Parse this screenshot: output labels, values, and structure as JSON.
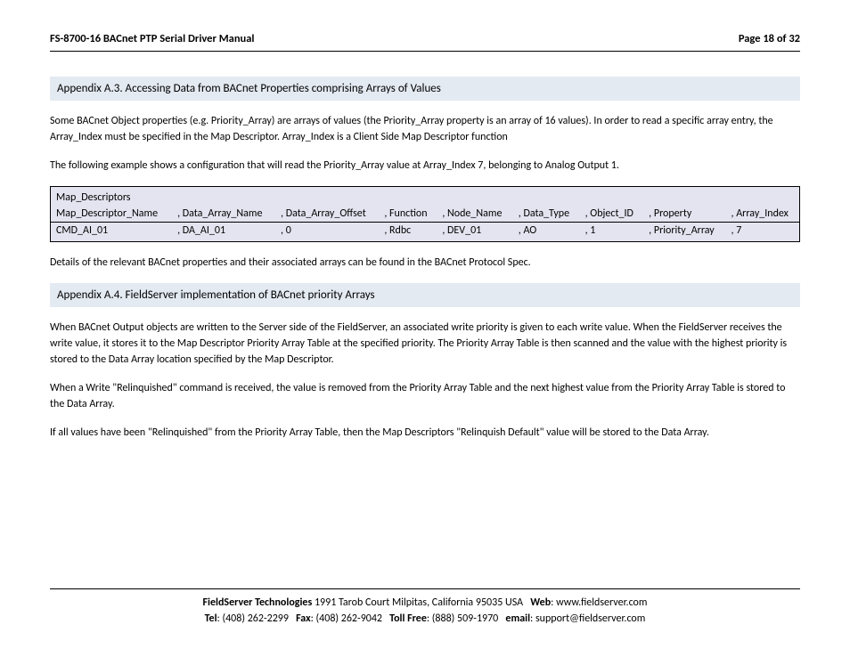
{
  "header": {
    "title": "FS-8700-16 BACnet PTP Serial Driver Manual",
    "page": "Page 18 of 32"
  },
  "sectionA3": {
    "heading": "Appendix A.3.  Accessing Data from BACnet Properties comprising Arrays of Values",
    "p1": "Some BACnet Object properties (e.g. Priority_Array) are arrays of values (the Priority_Array property is an array of 16 values).  In order to read a specific array entry, the Array_Index must be specified in the Map Descriptor.  Array_Index is a Client Side Map Descriptor function",
    "p2": "The following example shows a configuration that will read the Priority_Array value at Array_Index 7, belonging to Analog Output 1."
  },
  "table": {
    "title": "Map_Descriptors",
    "headers": [
      "Map_Descriptor_Name",
      ", Data_Array_Name",
      ", Data_Array_Offset",
      ", Function",
      ", Node_Name",
      ", Data_Type",
      ", Object_ID",
      ", Property",
      ", Array_Index"
    ],
    "row": [
      "CMD_AI_01",
      ", DA_AI_01",
      ", 0",
      ", Rdbc",
      ", DEV_01",
      ", AO",
      ", 1",
      ", Priority_Array",
      ", 7"
    ]
  },
  "pAfterTable": "Details of the relevant BACnet properties and their associated arrays can be found in the BACnet Protocol Spec.",
  "sectionA4": {
    "heading": "Appendix A.4.  FieldServer implementation of BACnet priority Arrays",
    "p1": "When BACnet Output objects are written to the Server side of the FieldServer, an associated write priority is given to each write value.  When the FieldServer receives the write value, it stores it to the Map Descriptor Priority Array Table at the specified priority.  The Priority Array Table is then scanned and the value with the highest priority is stored to the Data Array location specified by the Map Descriptor.",
    "p2": "When a Write \"Relinquished\" command is received, the value is removed from the Priority Array Table and the next highest value from the Priority Array Table is stored to the Data Array.",
    "p3": "If all values have been \"Relinquished\" from the Priority Array Table, then the Map Descriptors \"Relinquish Default\" value will be stored to the Data Array."
  },
  "footer": {
    "company": "FieldServer Technologies",
    "address": "1991 Tarob Court Milpitas, California 95035 USA",
    "webLabel": "Web",
    "web": ": www.fieldserver.com",
    "telLabel": "Tel",
    "tel": ": (408) 262-2299",
    "faxLabel": "Fax",
    "fax": ": (408) 262-9042",
    "tollLabel": "Toll Free",
    "toll": ": (888) 509-1970",
    "emailLabel": "email",
    "email": ": support@fieldserver.com"
  }
}
